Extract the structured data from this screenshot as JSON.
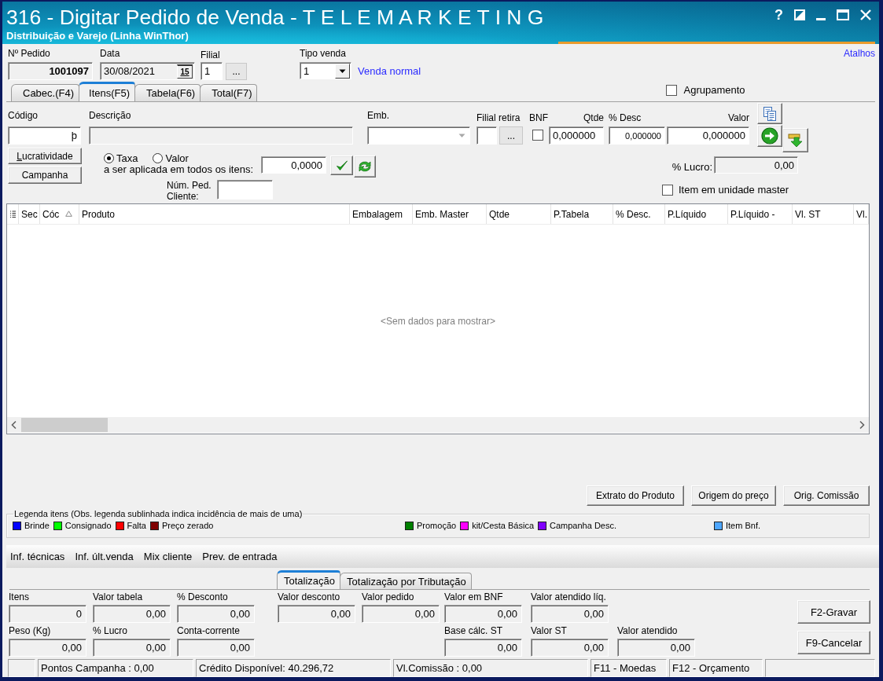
{
  "window": {
    "title": "316 - Digitar Pedido de Venda - T E L E M A R K E T I N G",
    "subtitle": "Distribuição e Varejo (Linha WinThor)",
    "help": "?"
  },
  "header": {
    "pedido": {
      "label": "Nº Pedido",
      "value": "1001097"
    },
    "data": {
      "label": "Data",
      "value": "30/08/2021",
      "calendar": "15"
    },
    "filial": {
      "label": "Filial",
      "value": "1",
      "button": "..."
    },
    "tipo_venda": {
      "label": "Tipo venda",
      "value": "1",
      "description": "Venda normal"
    },
    "shortcuts": "Atalhos"
  },
  "tabs": [
    {
      "label": "Cabec.(F4)",
      "selected": false
    },
    {
      "label": "Itens(F5)",
      "selected": true
    },
    {
      "label": "Tabela(F6)",
      "selected": false
    },
    {
      "label": "Total(F7)",
      "selected": false
    }
  ],
  "agrupamento": {
    "label": "Agrupamento",
    "checked": false
  },
  "item_entry": {
    "codigo": {
      "label": "Código",
      "value": "þ"
    },
    "descricao": {
      "label": "Descrição"
    },
    "emb": {
      "label": "Emb.",
      "disabled": true
    },
    "filial_retira": {
      "label": "Filial retira",
      "button": "..."
    },
    "bnf": {
      "label": "BNF",
      "checked": false
    },
    "qtde": {
      "label": "Qtde",
      "value": "0,000000"
    },
    "desconto": {
      "label": "% Desc",
      "value": "0,000000"
    },
    "valor": {
      "label": "Valor",
      "value": "0,000000"
    }
  },
  "side_buttons": [
    {
      "label": "Lucratividade",
      "mnemonic": true
    },
    {
      "label": "Campanha",
      "mnemonic": false
    }
  ],
  "rate": {
    "options": [
      {
        "label": "Taxa",
        "selected": true
      },
      {
        "label": "Valor",
        "selected": false
      }
    ],
    "caption": "a ser aplicada em todos os itens:",
    "value": "0,0000"
  },
  "num_ped_cliente": {
    "label": "Núm. Ped. Cliente:"
  },
  "lucro": {
    "label": "% Lucro:",
    "value": "0,00"
  },
  "item_master": {
    "label": "Item em unidade master",
    "checked": false
  },
  "grid": {
    "columns": [
      {
        "label": "Sec",
        "sorted": false
      },
      {
        "label": "Cóc",
        "sorted": true
      },
      {
        "label": "Produto",
        "sorted": false
      },
      {
        "label": "Embalagem",
        "sorted": false
      },
      {
        "label": "Emb. Master",
        "sorted": false
      },
      {
        "label": "Qtde",
        "sorted": false
      },
      {
        "label": "P.Tabela",
        "sorted": false
      },
      {
        "label": "% Desc.",
        "sorted": false
      },
      {
        "label": "P.Líquido",
        "sorted": false
      },
      {
        "label": "P.Líquido -",
        "sorted": false
      },
      {
        "label": "Vl. ST",
        "sorted": false
      },
      {
        "label": "Vl.",
        "sorted": false
      }
    ],
    "empty_text": "<Sem dados para mostrar>"
  },
  "action_buttons": [
    "Extrato do Produto",
    "Origem do preço",
    "Orig. Comissão"
  ],
  "legend": {
    "title": "Legenda itens (Obs. legenda sublinhada indica incidência de mais de uma)",
    "groups": [
      [
        {
          "label": "Brinde",
          "color": "#0000ff"
        },
        {
          "label": "Consignado",
          "color": "#00ff00"
        },
        {
          "label": "Falta",
          "color": "#ff0000"
        },
        {
          "label": "Preço zerado",
          "color": "#800000"
        }
      ],
      [
        {
          "label": "Promoção",
          "color": "#008000"
        },
        {
          "label": "kit/Cesta Básica",
          "color": "#ff00ff"
        },
        {
          "label": "Campanha Desc.",
          "color": "#8000ff"
        }
      ],
      [
        {
          "label": "Item Bnf.",
          "color": "#4da6ff"
        }
      ]
    ]
  },
  "info_toolbar": [
    "Inf. técnicas",
    "Inf. últ.venda",
    "Mix cliente",
    "Prev. de entrada"
  ],
  "total_tabs": [
    {
      "label": "Totalização",
      "selected": true
    },
    {
      "label": "Totalização por Tributação",
      "selected": false
    }
  ],
  "totals": [
    {
      "label": "Itens",
      "value": "0"
    },
    {
      "label": "Valor tabela",
      "value": "0,00"
    },
    {
      "label": "% Desconto",
      "value": "0,00"
    },
    {
      "label": "Valor desconto",
      "value": "0,00"
    },
    {
      "label": "Valor pedido",
      "value": "0,00"
    },
    {
      "label": "Valor em BNF",
      "value": "0,00"
    },
    {
      "label": "Valor atendido líq.",
      "value": "0,00"
    },
    {
      "label": "Peso (Kg)",
      "value": "0,00"
    },
    {
      "label": "% Lucro",
      "value": "0,00"
    },
    {
      "label": "Conta-corrente",
      "value": "0,00"
    },
    {
      "label": "Base cálc. ST",
      "value": "0,00"
    },
    {
      "label": "Valor ST",
      "value": "0,00"
    },
    {
      "label": "Valor atendido",
      "value": "0,00"
    }
  ],
  "buttons": [
    "F2-Gravar",
    "F9-Cancelar"
  ],
  "status_bar": [
    "Pontos Campanha : 0,00",
    "Crédito Disponível: 40.296,72",
    "Vl.Comissão : 0,00",
    "F11 - Moedas",
    "F12 - Orçamento"
  ]
}
